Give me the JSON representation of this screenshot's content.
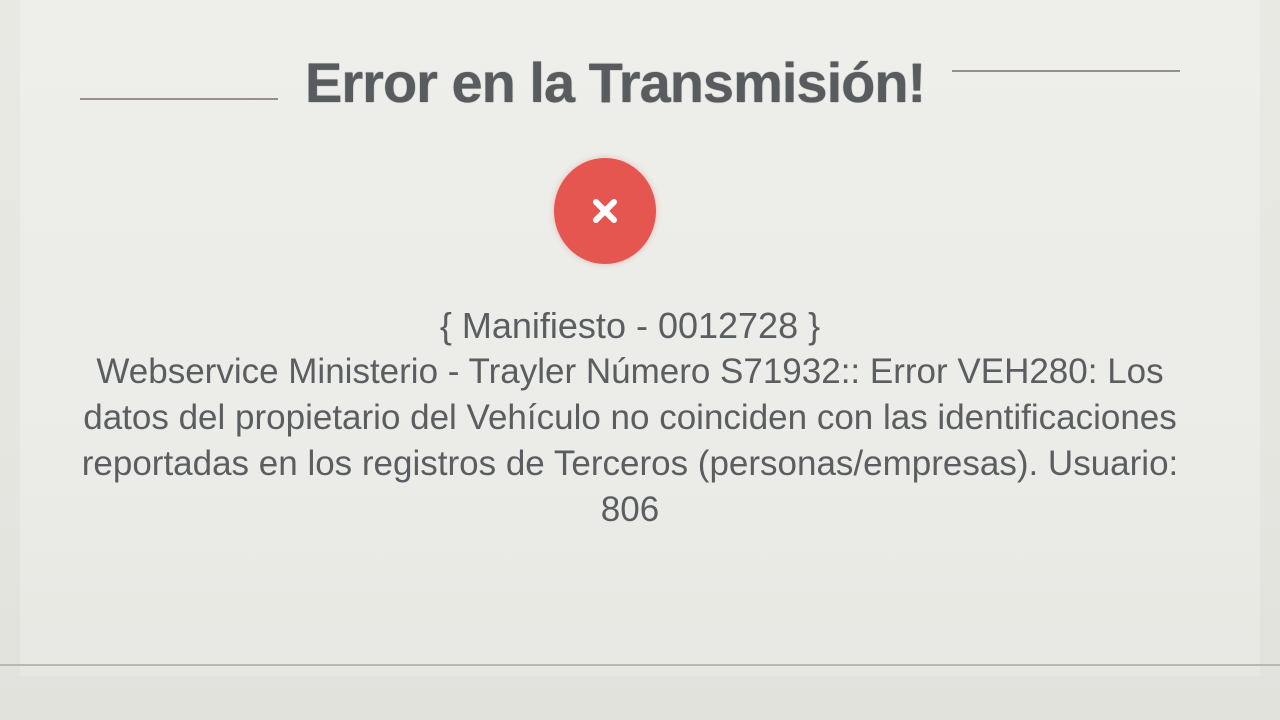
{
  "dialog": {
    "title": "Error en la Transmisión!",
    "icon": "error-x-icon",
    "icon_color": "#e4564f",
    "manifest": "{ Manifiesto - 0012728 }",
    "message": "Webservice Ministerio - Trayler Número S71932:: Error VEH280: Los datos del propietario del Vehículo no coinciden con las identificaciones reportadas en los registros de Terceros (personas/empresas). Usuario: 806"
  }
}
